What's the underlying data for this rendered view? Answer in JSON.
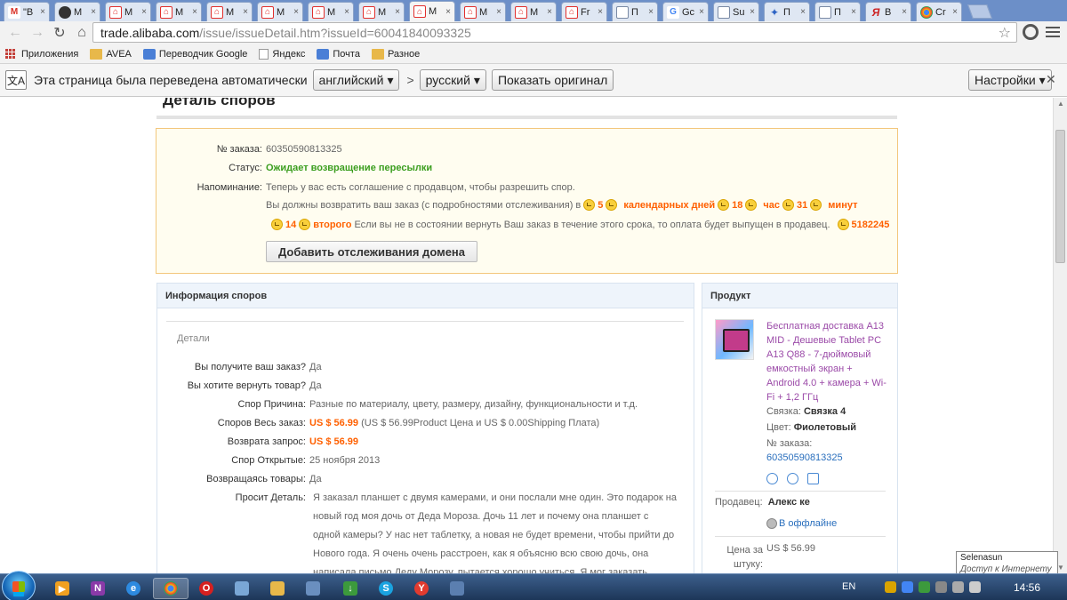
{
  "tabs": [
    {
      "title": "\"В",
      "favicon": "gmail-icon",
      "active": false
    },
    {
      "title": "M",
      "favicon": "user-icon",
      "active": false
    },
    {
      "title": "M",
      "favicon": "alibaba-icon",
      "active": false
    },
    {
      "title": "M",
      "favicon": "alibaba-icon",
      "active": false
    },
    {
      "title": "M",
      "favicon": "alibaba-icon",
      "active": false
    },
    {
      "title": "M",
      "favicon": "alibaba-icon",
      "active": false
    },
    {
      "title": "M",
      "favicon": "alibaba-icon",
      "active": false
    },
    {
      "title": "M",
      "favicon": "alibaba-icon",
      "active": false
    },
    {
      "title": "M",
      "favicon": "alibaba-icon",
      "active": true
    },
    {
      "title": "M",
      "favicon": "alibaba-icon",
      "active": false
    },
    {
      "title": "M",
      "favicon": "alibaba-icon",
      "active": false
    },
    {
      "title": "Fr",
      "favicon": "alibaba-icon",
      "active": false
    },
    {
      "title": "П",
      "favicon": "document-icon",
      "active": false
    },
    {
      "title": "Gc",
      "favicon": "google-icon",
      "active": false
    },
    {
      "title": "Su",
      "favicon": "document-icon",
      "active": false
    },
    {
      "title": "П",
      "favicon": "star-icon",
      "active": false
    },
    {
      "title": "П",
      "favicon": "document-icon",
      "active": false
    },
    {
      "title": "В",
      "favicon": "yandex-icon",
      "active": false
    },
    {
      "title": "Cr",
      "favicon": "chrome-icon",
      "active": false
    }
  ],
  "toolbar": {
    "url_host": "trade.alibaba.com",
    "url_path": "/issue/issueDetail.htm?issueId=60041840093325"
  },
  "bookmarks": [
    {
      "label": "Приложения",
      "icon": "apps-icon"
    },
    {
      "label": "AVEA",
      "icon": "folder-icon"
    },
    {
      "label": "Переводчик Google",
      "icon": "translate-icon"
    },
    {
      "label": "Яндекс",
      "icon": "page-icon"
    },
    {
      "label": "Почта",
      "icon": "mail-icon"
    },
    {
      "label": "Разное",
      "icon": "folder-icon"
    }
  ],
  "translate_bar": {
    "message": "Эта страница была переведена автоматически",
    "from_language": "английский",
    "arrow": ">",
    "to_language": "русский",
    "show_original": "Показать оригинал",
    "settings": "Настройки"
  },
  "page": {
    "title": "Деталь споров",
    "notice": {
      "order_label": "№ заказа:",
      "order_value": "60350590813325",
      "status_label": "Статус:",
      "status_value": "Ожидает возвращение пересылки",
      "reminder_label": "Напоминание:",
      "reminder_line1": "Теперь у вас есть соглашение с продавцом, чтобы разрешить спор.",
      "reminder_line2": "Вы должны возвратить ваш заказ (с подробностями отслеживания) в",
      "countdown": {
        "days": "5",
        "days_label": "календарных дней",
        "hours": "18",
        "hours_label": "час",
        "minutes": "31",
        "minutes_label": "минут",
        "seconds": "14",
        "seconds_label": "второго"
      },
      "reminder_line3": "Если вы не в состоянии вернуть Ваш заказ в течение этого срока, то оплата будет выпущен в продавец.",
      "code": "5182245",
      "add_tracking_button": "Добавить отслеживания домена"
    },
    "dispute_info": {
      "header": "Информация споров",
      "details_label": "Детали",
      "rows": [
        {
          "label": "Вы получите ваш заказ?",
          "value": "Да"
        },
        {
          "label": "Вы хотите вернуть товар?",
          "value": "Да"
        },
        {
          "label": "Спор Причина:",
          "value": "Разные по материалу, цвету, размеру, дизайну, функциональности и т.д."
        },
        {
          "label": "Споров Весь заказ:",
          "value_bold": "US $ 56.99",
          "value": "(US $ 56.99Product Цена и US $ 0.00Shipping Плата)"
        },
        {
          "label": "Возврата запрос:",
          "value_bold": "US $ 56.99",
          "value": ""
        },
        {
          "label": "Спор Открытые:",
          "value": "25 ноября 2013"
        },
        {
          "label": "Возвращаясь товары:",
          "value": "Да"
        }
      ],
      "comment_label": "Просит Деталь:",
      "comment": "Я заказал планшет с двумя камерами, и они послали мне один. Это подарок на новый год моя дочь от Деда Мороза. Дочь 11 лет и почему она планшет с одной камеры? У нас нет таблетку, а новая не будет времени, чтобы прийти до Нового года. Я очень очень расстроен, как я объясню всю свою дочь, она написала письмо Деду Морозу, пытается хорошо учиться. Я мог заказать таблетка от другого"
    },
    "product": {
      "header": "Продукт",
      "title": "Бесплатная доставка A13 MID - Дешевые Tablet PC A13 Q88 - 7-дюймовый емкостный экран + Android 4.0 + камера + Wi-Fi + 1,2 ГГц",
      "bundle_label": "Связка:",
      "bundle_value": "Связка 4",
      "color_label": "Цвет:",
      "color_value": "Фиолетовый",
      "order_label": "№ заказа:",
      "order_value": "60350590813325",
      "seller_label": "Продавец:",
      "seller_value": "Алекс ке",
      "offline": "В оффлайне",
      "price_label_1": "Цена за",
      "price_label_2": "штуку:",
      "price_value": "US $ 56.99"
    }
  },
  "taskbar": {
    "language": "EN",
    "clock": "14:56",
    "notification_title": "Selenasun",
    "notification_status": "Доступ к Интернету"
  }
}
